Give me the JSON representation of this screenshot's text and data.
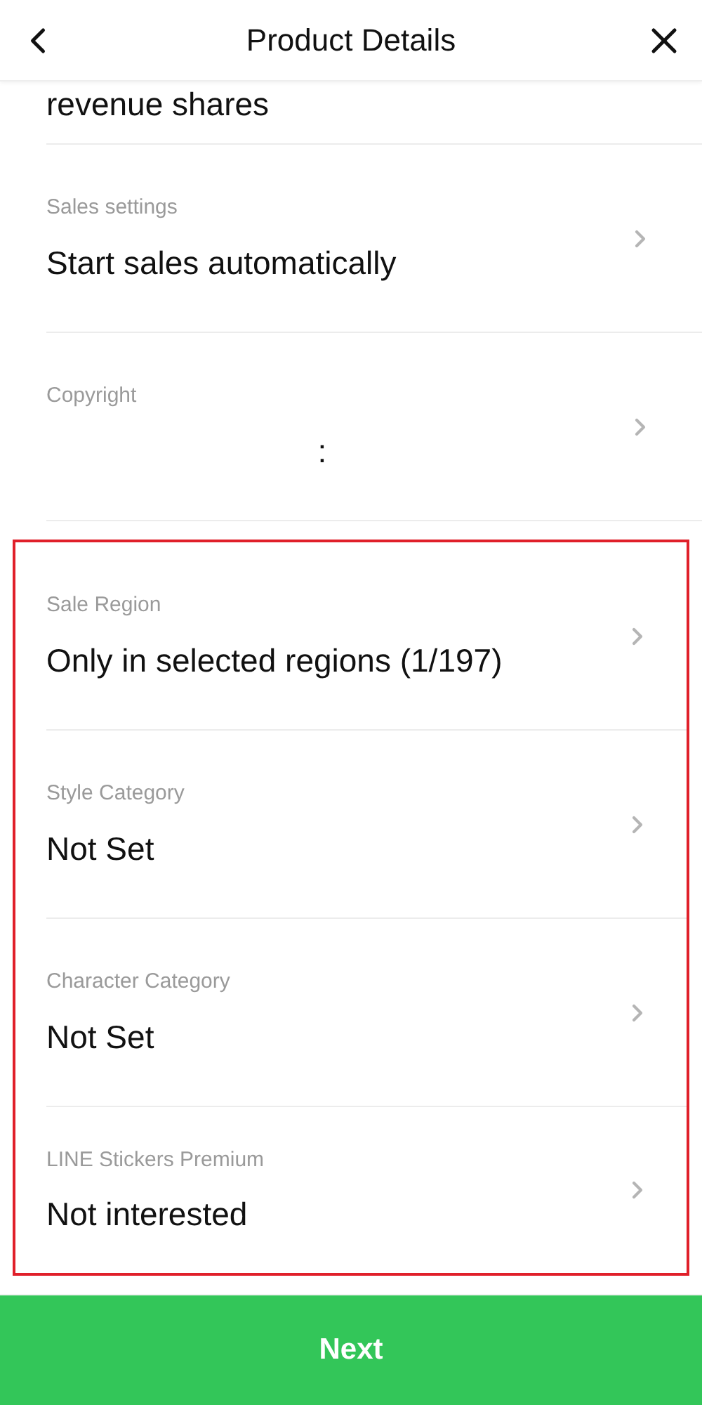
{
  "header": {
    "title": "Product Details"
  },
  "partial_row": {
    "value": "revenue shares"
  },
  "sections": [
    {
      "highlighted": false,
      "rows": [
        {
          "label": "Sales settings",
          "value": "Start sales automatically"
        },
        {
          "label": "Copyright",
          "value": ":"
        }
      ]
    },
    {
      "highlighted": true,
      "rows": [
        {
          "label": "Sale Region",
          "value": "Only in selected regions (1/197)"
        },
        {
          "label": "Style Category",
          "value": "Not Set"
        },
        {
          "label": "Character Category",
          "value": "Not Set"
        },
        {
          "label": "LINE Stickers Premium",
          "value": "Not interested"
        }
      ]
    }
  ],
  "footer": {
    "button": "Next"
  }
}
